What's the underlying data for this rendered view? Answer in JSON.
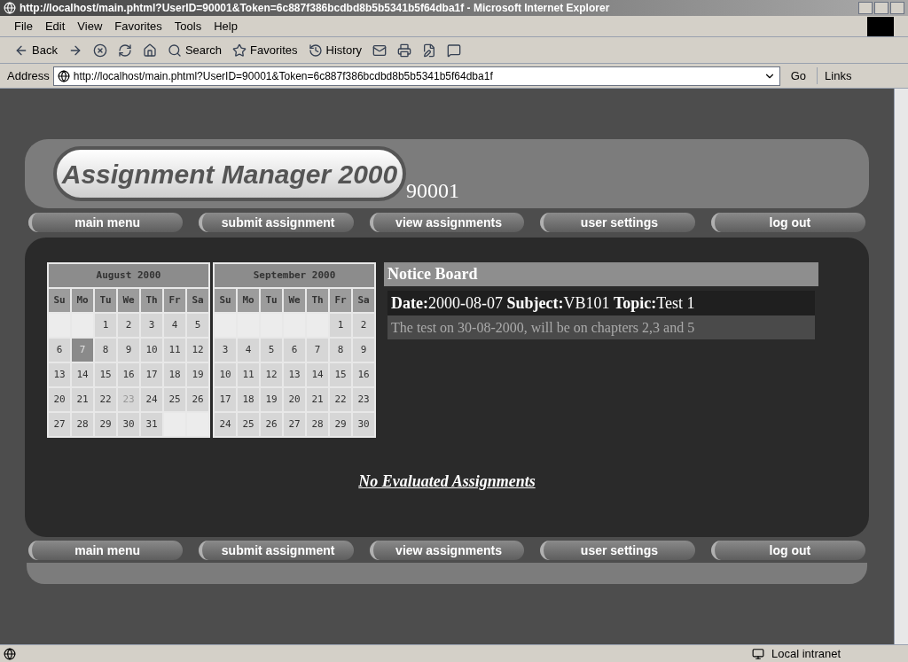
{
  "window": {
    "title": "http://localhost/main.phtml?UserID=90001&Token=6c887f386bcdbd8b5b5341b5f64dba1f - Microsoft Internet Explorer"
  },
  "menu": [
    "File",
    "Edit",
    "View",
    "Favorites",
    "Tools",
    "Help"
  ],
  "toolbar": [
    {
      "kind": "back",
      "label": "Back"
    },
    {
      "kind": "forward"
    },
    {
      "kind": "stop"
    },
    {
      "kind": "refresh"
    },
    {
      "kind": "home"
    },
    {
      "kind": "search",
      "label": "Search"
    },
    {
      "kind": "favorites",
      "label": "Favorites"
    },
    {
      "kind": "history",
      "label": "History"
    },
    {
      "kind": "mail"
    },
    {
      "kind": "print"
    },
    {
      "kind": "edit"
    },
    {
      "kind": "discuss"
    }
  ],
  "address": {
    "label": "Address",
    "value": "http://localhost/main.phtml?UserID=90001&Token=6c887f386bcdbd8b5b5341b5f64dba1f",
    "go": "Go",
    "links": "Links"
  },
  "page": {
    "logo": "Assignment Manager 2000",
    "user_id": "90001",
    "nav_top": [
      "main menu",
      "submit assignment",
      "view assignments",
      "user settings",
      "log out"
    ],
    "calendars": [
      {
        "title": "August 2000",
        "weekdays": [
          "Su",
          "Mo",
          "Tu",
          "We",
          "Th",
          "Fr",
          "Sa"
        ],
        "weeks": [
          [
            {
              "kind": "blank"
            },
            {
              "kind": "blank"
            },
            {
              "kind": "day",
              "day": "1",
              "selected": false,
              "muted": false
            },
            {
              "kind": "day",
              "day": "2",
              "selected": false,
              "muted": false
            },
            {
              "kind": "day",
              "day": "3",
              "selected": false,
              "muted": false
            },
            {
              "kind": "day",
              "day": "4",
              "selected": false,
              "muted": false
            },
            {
              "kind": "day",
              "day": "5",
              "selected": false,
              "muted": false
            }
          ],
          [
            {
              "kind": "day",
              "day": "6",
              "selected": false,
              "muted": false
            },
            {
              "kind": "day",
              "day": "7",
              "selected": true,
              "muted": false
            },
            {
              "kind": "day",
              "day": "8",
              "selected": false,
              "muted": false
            },
            {
              "kind": "day",
              "day": "9",
              "selected": false,
              "muted": false
            },
            {
              "kind": "day",
              "day": "10",
              "selected": false,
              "muted": false
            },
            {
              "kind": "day",
              "day": "11",
              "selected": false,
              "muted": false
            },
            {
              "kind": "day",
              "day": "12",
              "selected": false,
              "muted": false
            }
          ],
          [
            {
              "kind": "day",
              "day": "13",
              "selected": false,
              "muted": false
            },
            {
              "kind": "day",
              "day": "14",
              "selected": false,
              "muted": false
            },
            {
              "kind": "day",
              "day": "15",
              "selected": false,
              "muted": false
            },
            {
              "kind": "day",
              "day": "16",
              "selected": false,
              "muted": false
            },
            {
              "kind": "day",
              "day": "17",
              "selected": false,
              "muted": false
            },
            {
              "kind": "day",
              "day": "18",
              "selected": false,
              "muted": false
            },
            {
              "kind": "day",
              "day": "19",
              "selected": false,
              "muted": false
            }
          ],
          [
            {
              "kind": "day",
              "day": "20",
              "selected": false,
              "muted": false
            },
            {
              "kind": "day",
              "day": "21",
              "selected": false,
              "muted": false
            },
            {
              "kind": "day",
              "day": "22",
              "selected": false,
              "muted": false
            },
            {
              "kind": "day",
              "day": "23",
              "selected": false,
              "muted": true
            },
            {
              "kind": "day",
              "day": "24",
              "selected": false,
              "muted": false
            },
            {
              "kind": "day",
              "day": "25",
              "selected": false,
              "muted": false
            },
            {
              "kind": "day",
              "day": "26",
              "selected": false,
              "muted": false
            }
          ],
          [
            {
              "kind": "day",
              "day": "27",
              "selected": false,
              "muted": false
            },
            {
              "kind": "day",
              "day": "28",
              "selected": false,
              "muted": false
            },
            {
              "kind": "day",
              "day": "29",
              "selected": false,
              "muted": false
            },
            {
              "kind": "day",
              "day": "30",
              "selected": false,
              "muted": false
            },
            {
              "kind": "day",
              "day": "31",
              "selected": false,
              "muted": false
            },
            {
              "kind": "blank"
            },
            {
              "kind": "blank"
            }
          ]
        ]
      },
      {
        "title": "September 2000",
        "weekdays": [
          "Su",
          "Mo",
          "Tu",
          "We",
          "Th",
          "Fr",
          "Sa"
        ],
        "weeks": [
          [
            {
              "kind": "blank"
            },
            {
              "kind": "blank"
            },
            {
              "kind": "blank"
            },
            {
              "kind": "blank"
            },
            {
              "kind": "blank"
            },
            {
              "kind": "day",
              "day": "1",
              "selected": false,
              "muted": false
            },
            {
              "kind": "day",
              "day": "2",
              "selected": false,
              "muted": false
            }
          ],
          [
            {
              "kind": "day",
              "day": "3",
              "selected": false,
              "muted": false
            },
            {
              "kind": "day",
              "day": "4",
              "selected": false,
              "muted": false
            },
            {
              "kind": "day",
              "day": "5",
              "selected": false,
              "muted": false
            },
            {
              "kind": "day",
              "day": "6",
              "selected": false,
              "muted": false
            },
            {
              "kind": "day",
              "day": "7",
              "selected": false,
              "muted": false
            },
            {
              "kind": "day",
              "day": "8",
              "selected": false,
              "muted": false
            },
            {
              "kind": "day",
              "day": "9",
              "selected": false,
              "muted": false
            }
          ],
          [
            {
              "kind": "day",
              "day": "10",
              "selected": false,
              "muted": false
            },
            {
              "kind": "day",
              "day": "11",
              "selected": false,
              "muted": false
            },
            {
              "kind": "day",
              "day": "12",
              "selected": false,
              "muted": false
            },
            {
              "kind": "day",
              "day": "13",
              "selected": false,
              "muted": false
            },
            {
              "kind": "day",
              "day": "14",
              "selected": false,
              "muted": false
            },
            {
              "kind": "day",
              "day": "15",
              "selected": false,
              "muted": false
            },
            {
              "kind": "day",
              "day": "16",
              "selected": false,
              "muted": false
            }
          ],
          [
            {
              "kind": "day",
              "day": "17",
              "selected": false,
              "muted": false
            },
            {
              "kind": "day",
              "day": "18",
              "selected": false,
              "muted": false
            },
            {
              "kind": "day",
              "day": "19",
              "selected": false,
              "muted": false
            },
            {
              "kind": "day",
              "day": "20",
              "selected": false,
              "muted": false
            },
            {
              "kind": "day",
              "day": "21",
              "selected": false,
              "muted": false
            },
            {
              "kind": "day",
              "day": "22",
              "selected": false,
              "muted": false
            },
            {
              "kind": "day",
              "day": "23",
              "selected": false,
              "muted": false
            }
          ],
          [
            {
              "kind": "day",
              "day": "24",
              "selected": false,
              "muted": false
            },
            {
              "kind": "day",
              "day": "25",
              "selected": false,
              "muted": false
            },
            {
              "kind": "day",
              "day": "26",
              "selected": false,
              "muted": false
            },
            {
              "kind": "day",
              "day": "27",
              "selected": false,
              "muted": false
            },
            {
              "kind": "day",
              "day": "28",
              "selected": false,
              "muted": false
            },
            {
              "kind": "day",
              "day": "29",
              "selected": false,
              "muted": false
            },
            {
              "kind": "day",
              "day": "30",
              "selected": false,
              "muted": false
            }
          ]
        ]
      }
    ],
    "notice_board": {
      "title": "Notice Board",
      "notices": [
        {
          "heading": "**Date:**2000-08-07 **Subject:**VB101 **Topic:**Test 1",
          "body": "The test on 30-08-2000, will be on chapters 2,3 and 5"
        }
      ]
    },
    "message": "No Evaluated Assignments",
    "nav_bottom": [
      "main menu",
      "submit assignment",
      "view assignments",
      "user settings",
      "log out"
    ]
  },
  "status_bar": {
    "zone": "Local intranet"
  }
}
